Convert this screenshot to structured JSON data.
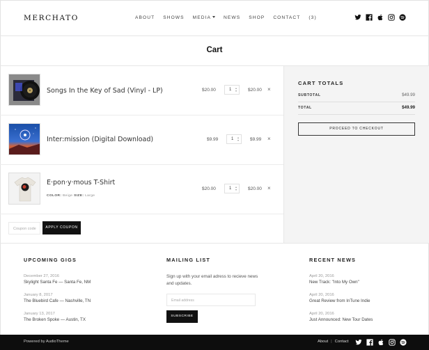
{
  "header": {
    "logo": "MERCHATO",
    "nav": [
      {
        "label": "ABOUT"
      },
      {
        "label": "SHOWS"
      },
      {
        "label": "MEDIA",
        "has_caret": true
      },
      {
        "label": "NEWS"
      },
      {
        "label": "SHOP"
      },
      {
        "label": "CONTACT"
      },
      {
        "label": "(3)"
      }
    ],
    "social_icons": [
      "twitter-icon",
      "facebook-icon",
      "apple-icon",
      "instagram-icon",
      "spotify-icon"
    ]
  },
  "page": {
    "title": "Cart"
  },
  "cart": {
    "items": [
      {
        "name": "Songs In the Key of Sad (Vinyl - LP)",
        "price": "$20.00",
        "qty": "1",
        "subtotal": "$20.00",
        "thumb": "vinyl-record-image"
      },
      {
        "name": "Inter:mission (Digital Download)",
        "price": "$9.99",
        "qty": "1",
        "subtotal": "$9.99",
        "thumb": "album-cover-image"
      },
      {
        "name": "E·pon·y·mous T-Shirt",
        "price": "$20.00",
        "qty": "1",
        "subtotal": "$20.00",
        "thumb": "tshirt-image",
        "meta": [
          {
            "key": "COLOR:",
            "value": "Beige"
          },
          {
            "key": "SIZE:",
            "value": "Large"
          }
        ]
      }
    ],
    "remove_glyph": "×",
    "coupon_placeholder": "Coupon code",
    "apply_label": "APPLY COUPON"
  },
  "totals": {
    "heading": "CART TOTALS",
    "subtotal_label": "SUBTOTAL",
    "subtotal_value": "$49.99",
    "total_label": "TOTAL",
    "total_value": "$49.99",
    "checkout_label": "PROCEED TO CHECKOUT"
  },
  "footer": {
    "gigs": {
      "heading": "UPCOMING GIGS",
      "items": [
        {
          "date": "December 27, 2016",
          "text": "Skylight Santa Fe — Santa Fe, NM"
        },
        {
          "date": "January 8, 2017",
          "text": "The Bluebird Cafe — Nashville, TN"
        },
        {
          "date": "January 13, 2017",
          "text": "The Broken Spoke — Austin, TX"
        }
      ]
    },
    "mailing": {
      "heading": "MAILING LIST",
      "text": "Sign up with your email adress to recieve news and updates.",
      "email_placeholder": "Email address",
      "subscribe_label": "SUBSCRIBE"
    },
    "news": {
      "heading": "RECENT NEWS",
      "items": [
        {
          "date": "April 20, 2016",
          "text": "New Track: \"Into My Own\""
        },
        {
          "date": "April 20, 2016",
          "text": "Great Review from InTune Indie"
        },
        {
          "date": "April 20, 2016",
          "text": "Just Announced: New Tour Dates"
        }
      ]
    }
  },
  "bottom": {
    "powered": "Powered by AudioTheme",
    "links": [
      {
        "label": "About"
      },
      {
        "label": "Contact"
      }
    ],
    "separator": "|"
  }
}
